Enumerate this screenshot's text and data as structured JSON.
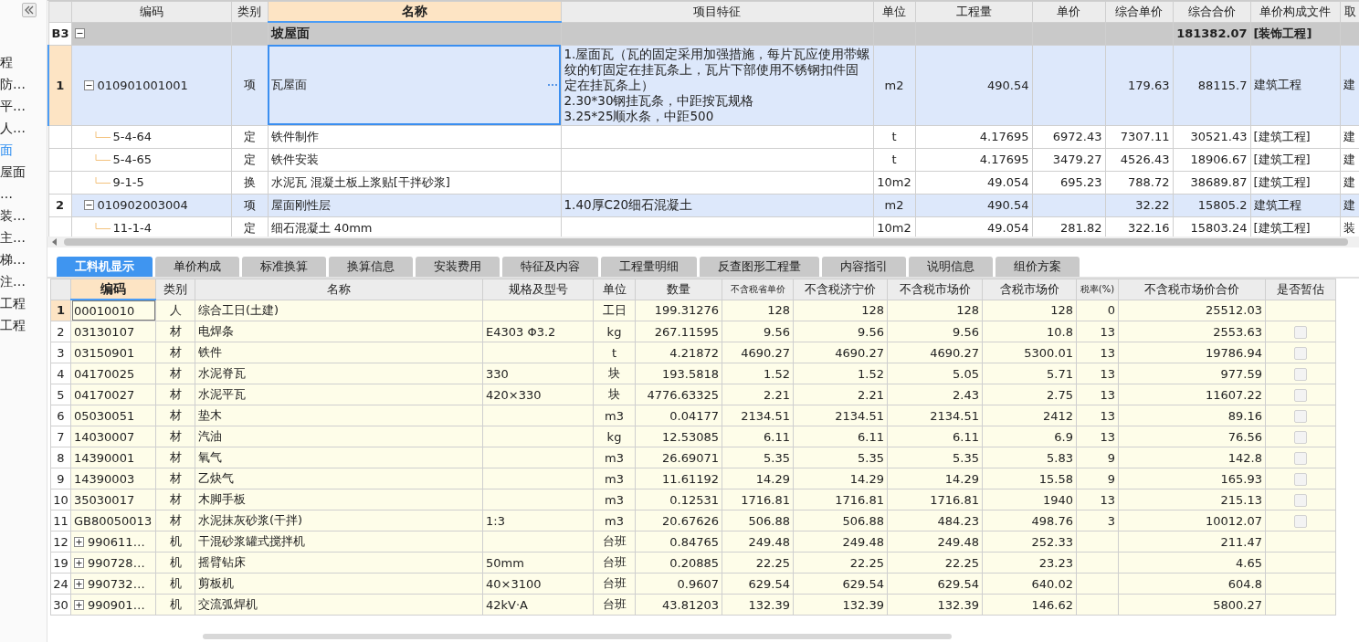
{
  "sidebar": {
    "items": [
      {
        "label": "程",
        "selected": false
      },
      {
        "label": "防…",
        "selected": false
      },
      {
        "label": "平…",
        "selected": false
      },
      {
        "label": "人…",
        "selected": false
      },
      {
        "label": "面",
        "selected": true
      },
      {
        "label": "屋面",
        "selected": false
      },
      {
        "label": "…",
        "selected": false
      },
      {
        "label": "装…",
        "selected": false
      },
      {
        "label": "主…",
        "selected": false
      },
      {
        "label": "梯…",
        "selected": false
      },
      {
        "label": "注…",
        "selected": false
      },
      {
        "label": "工程",
        "selected": false
      },
      {
        "label": "工程",
        "selected": false
      }
    ]
  },
  "bill_table": {
    "columns": [
      {
        "label": "编码",
        "selected": false
      },
      {
        "label": "类别",
        "selected": false
      },
      {
        "label": "名称",
        "selected": true
      },
      {
        "label": "项目特征",
        "selected": false
      },
      {
        "label": "单位",
        "selected": false
      },
      {
        "label": "工程量",
        "selected": false
      },
      {
        "label": "单价",
        "selected": false
      },
      {
        "label": "综合单价",
        "selected": false
      },
      {
        "label": "综合合价",
        "selected": false
      },
      {
        "label": "单价构成文件",
        "selected": false
      },
      {
        "label": "取",
        "selected": false
      }
    ],
    "rows": [
      {
        "kind": "section",
        "number": "B3",
        "expanded": true,
        "name": "坡屋面",
        "composite_total": "181382.07",
        "price_file": "[装饰工程]",
        "selected": false
      },
      {
        "kind": "item",
        "number": "1",
        "expanded": true,
        "code": "010901001001",
        "type": "项",
        "name": "瓦屋面",
        "features": [
          "1.屋面瓦（瓦的固定采用加强措施，每片瓦应使用带螺纹的钉固定在挂瓦条上，瓦片下部使用不锈钢扣件固定在挂瓦条上）",
          "2.30*30钢挂瓦条，中距按瓦规格",
          "3.25*25顺水条，中距500"
        ],
        "unit": "m2",
        "quantity": "490.54",
        "composite_unit_price": "179.63",
        "composite_total": "88115.7",
        "price_file": "建筑工程",
        "column_12": "建",
        "selected": true
      },
      {
        "kind": "quota",
        "code": "5-4-64",
        "type": "定",
        "name": "铁件制作",
        "unit": "t",
        "quantity": "4.17695",
        "unit_price": "6972.43",
        "composite_unit_price": "7307.11",
        "composite_total": "30521.43",
        "price_file": "[建筑工程]",
        "column_12": "建",
        "selected": false
      },
      {
        "kind": "quota",
        "code": "5-4-65",
        "type": "定",
        "name": "铁件安装",
        "unit": "t",
        "quantity": "4.17695",
        "unit_price": "3479.27",
        "composite_unit_price": "4526.43",
        "composite_total": "18906.67",
        "price_file": "[建筑工程]",
        "column_12": "建",
        "selected": false
      },
      {
        "kind": "quota",
        "code": "9-1-5",
        "type": "换",
        "name": "水泥瓦 混凝土板上浆贴[干拌砂浆]",
        "unit": "10m2",
        "quantity": "49.054",
        "unit_price": "695.23",
        "composite_unit_price": "788.72",
        "composite_total": "38689.87",
        "price_file": "[建筑工程]",
        "column_12": "建",
        "selected": false
      },
      {
        "kind": "item",
        "number": "2",
        "expanded": true,
        "code": "010902003004",
        "type": "项",
        "name": "屋面刚性层",
        "features": [
          "1.40厚C20细石混凝土"
        ],
        "unit": "m2",
        "quantity": "490.54",
        "composite_unit_price": "32.22",
        "composite_total": "15805.2",
        "price_file": "建筑工程",
        "column_12": "建",
        "selected": false
      },
      {
        "kind": "quota",
        "code": "11-1-4",
        "type": "定",
        "name": "细石混凝土 40mm",
        "unit": "10m2",
        "quantity": "49.054",
        "unit_price": "281.82",
        "composite_unit_price": "322.16",
        "composite_total": "15803.24",
        "price_file": "[建筑工程]",
        "column_12": "装",
        "selected": false
      }
    ]
  },
  "detail_tabs": [
    {
      "label": "工料机显示",
      "selected": true
    },
    {
      "label": "单价构成",
      "selected": false
    },
    {
      "label": "标准换算",
      "selected": false
    },
    {
      "label": "换算信息",
      "selected": false
    },
    {
      "label": "安装费用",
      "selected": false
    },
    {
      "label": "特征及内容",
      "selected": false
    },
    {
      "label": "工程量明细",
      "selected": false
    },
    {
      "label": "反查图形工程量",
      "selected": false
    },
    {
      "label": "内容指引",
      "selected": false
    },
    {
      "label": "说明信息",
      "selected": false
    },
    {
      "label": "组价方案",
      "selected": false
    }
  ],
  "resource_table": {
    "columns": [
      {
        "label": "编码",
        "selected": true
      },
      {
        "label": "类别",
        "selected": false
      },
      {
        "label": "名称",
        "selected": false
      },
      {
        "label": "规格及型号",
        "selected": false
      },
      {
        "label": "单位",
        "selected": false
      },
      {
        "label": "数量",
        "selected": false
      },
      {
        "label": "不含税省单价",
        "selected": false
      },
      {
        "label": "不含税济宁价",
        "selected": false
      },
      {
        "label": "不含税市场价",
        "selected": false
      },
      {
        "label": "含税市场价",
        "selected": false
      },
      {
        "label": "税率(%)",
        "selected": false
      },
      {
        "label": "不含税市场价合价",
        "selected": false
      },
      {
        "label": "是否暂估",
        "selected": false
      }
    ],
    "rows": [
      {
        "number": "1",
        "code": "00010010",
        "type": "人",
        "name": "综合工日(土建)",
        "unit": "工日",
        "quantity": "199.31276",
        "provincial_price": "128",
        "jining_price": "128",
        "market_price": "128",
        "market_price_with_tax": "128",
        "tax_rate": "0",
        "market_total": "25512.03",
        "selected": true
      },
      {
        "number": "2",
        "code": "03130107",
        "type": "材",
        "name": "电焊条",
        "spec": "E4303 Φ3.2",
        "unit": "kg",
        "quantity": "267.11595",
        "provincial_price": "9.56",
        "jining_price": "9.56",
        "market_price": "9.56",
        "market_price_with_tax": "10.8",
        "tax_rate": "13",
        "market_total": "2553.63",
        "provisional": false,
        "selected": false
      },
      {
        "number": "3",
        "code": "03150901",
        "type": "材",
        "name": "铁件",
        "unit": "t",
        "quantity": "4.21872",
        "provincial_price": "4690.27",
        "jining_price": "4690.27",
        "market_price": "4690.27",
        "market_price_with_tax": "5300.01",
        "tax_rate": "13",
        "market_total": "19786.94",
        "provisional": false,
        "selected": false
      },
      {
        "number": "4",
        "code": "04170025",
        "type": "材",
        "name": "水泥脊瓦",
        "spec": "330",
        "unit": "块",
        "quantity": "193.5818",
        "provincial_price": "1.52",
        "jining_price": "1.52",
        "market_price": "5.05",
        "market_price_with_tax": "5.71",
        "tax_rate": "13",
        "market_total": "977.59",
        "provisional": false,
        "selected": false
      },
      {
        "number": "5",
        "code": "04170027",
        "type": "材",
        "name": "水泥平瓦",
        "spec": "420×330",
        "unit": "块",
        "quantity": "4776.63325",
        "provincial_price": "2.21",
        "jining_price": "2.21",
        "market_price": "2.43",
        "market_price_with_tax": "2.75",
        "tax_rate": "13",
        "market_total": "11607.22",
        "provisional": false,
        "selected": false
      },
      {
        "number": "6",
        "code": "05030051",
        "type": "材",
        "name": "垫木",
        "unit": "m3",
        "quantity": "0.04177",
        "provincial_price": "2134.51",
        "jining_price": "2134.51",
        "market_price": "2134.51",
        "market_price_with_tax": "2412",
        "tax_rate": "13",
        "market_total": "89.16",
        "provisional": false,
        "selected": false
      },
      {
        "number": "7",
        "code": "14030007",
        "type": "材",
        "name": "汽油",
        "unit": "kg",
        "quantity": "12.53085",
        "provincial_price": "6.11",
        "jining_price": "6.11",
        "market_price": "6.11",
        "market_price_with_tax": "6.9",
        "tax_rate": "13",
        "market_total": "76.56",
        "provisional": false,
        "selected": false
      },
      {
        "number": "8",
        "code": "14390001",
        "type": "材",
        "name": "氧气",
        "unit": "m3",
        "quantity": "26.69071",
        "provincial_price": "5.35",
        "jining_price": "5.35",
        "market_price": "5.35",
        "market_price_with_tax": "5.83",
        "tax_rate": "9",
        "market_total": "142.8",
        "provisional": false,
        "selected": false
      },
      {
        "number": "9",
        "code": "14390003",
        "type": "材",
        "name": "乙炔气",
        "unit": "m3",
        "quantity": "11.61192",
        "provincial_price": "14.29",
        "jining_price": "14.29",
        "market_price": "14.29",
        "market_price_with_tax": "15.58",
        "tax_rate": "9",
        "market_total": "165.93",
        "provisional": false,
        "selected": false
      },
      {
        "number": "10",
        "code": "35030017",
        "type": "材",
        "name": "木脚手板",
        "unit": "m3",
        "quantity": "0.12531",
        "provincial_price": "1716.81",
        "jining_price": "1716.81",
        "market_price": "1716.81",
        "market_price_with_tax": "1940",
        "tax_rate": "13",
        "market_total": "215.13",
        "provisional": false,
        "selected": false
      },
      {
        "number": "11",
        "code": "GB80050013",
        "type": "材",
        "name": "水泥抹灰砂浆(干拌)",
        "spec": "1:3",
        "unit": "m3",
        "quantity": "20.67626",
        "provincial_price": "506.88",
        "jining_price": "506.88",
        "market_price": "484.23",
        "market_price_with_tax": "498.76",
        "tax_rate": "3",
        "market_total": "10012.07",
        "provisional": false,
        "selected": false
      },
      {
        "number": "12",
        "code": "990611…",
        "expanded": false,
        "type": "机",
        "name": "干混砂浆罐式搅拌机",
        "unit": "台班",
        "quantity": "0.84765",
        "provincial_price": "249.48",
        "jining_price": "249.48",
        "market_price": "249.48",
        "market_price_with_tax": "252.33",
        "market_total": "211.47",
        "selected": false
      },
      {
        "number": "19",
        "code": "990728…",
        "expanded": false,
        "type": "机",
        "name": "摇臂钻床",
        "spec": "50mm",
        "unit": "台班",
        "quantity": "0.20885",
        "provincial_price": "22.25",
        "jining_price": "22.25",
        "market_price": "22.25",
        "market_price_with_tax": "23.23",
        "market_total": "4.65",
        "selected": false
      },
      {
        "number": "24",
        "code": "990732…",
        "expanded": false,
        "type": "机",
        "name": "剪板机",
        "spec": "40×3100",
        "unit": "台班",
        "quantity": "0.9607",
        "provincial_price": "629.54",
        "jining_price": "629.54",
        "market_price": "629.54",
        "market_price_with_tax": "640.02",
        "market_total": "604.8",
        "selected": false
      },
      {
        "number": "30",
        "code": "990901…",
        "expanded": false,
        "type": "机",
        "name": "交流弧焊机",
        "spec": "42kV·A",
        "unit": "台班",
        "quantity": "43.81203",
        "provincial_price": "132.39",
        "jining_price": "132.39",
        "market_price": "132.39",
        "market_price_with_tax": "146.62",
        "market_total": "5800.27",
        "selected": false
      }
    ]
  }
}
